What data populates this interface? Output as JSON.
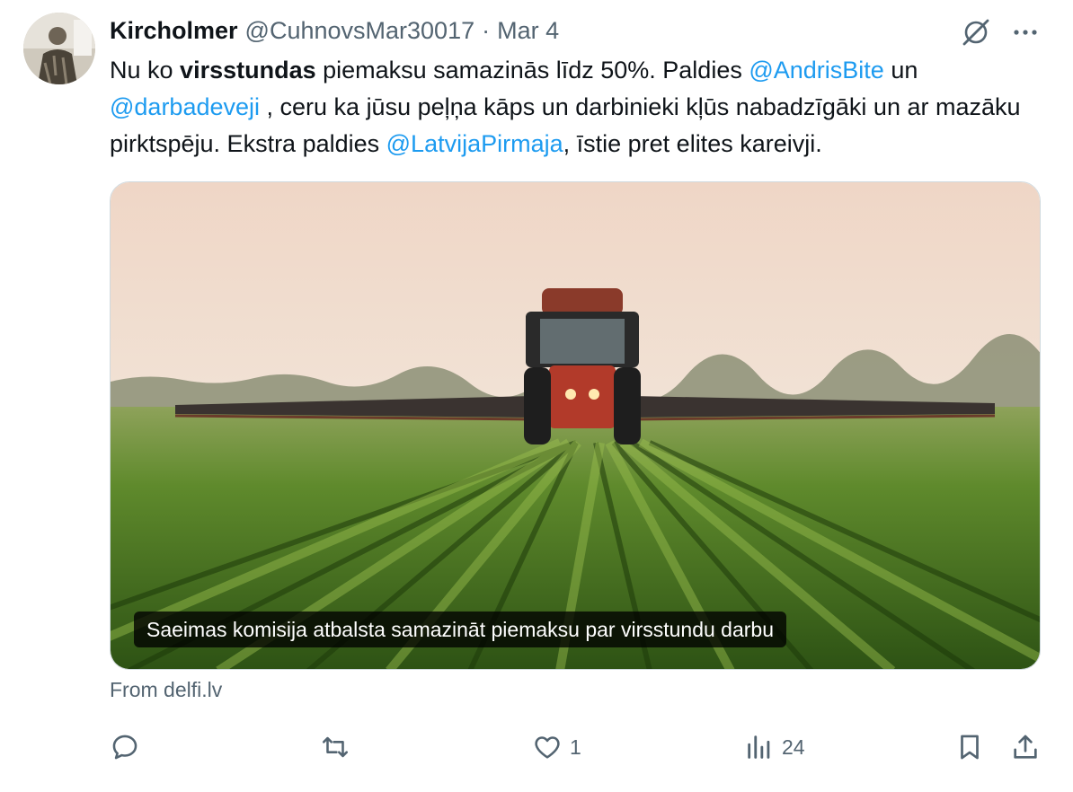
{
  "tweet": {
    "author_name": "Kircholmer",
    "author_handle": "@CuhnovsMar30017",
    "separator": "·",
    "date": "Mar 4",
    "text_segments": {
      "p1": "Nu ko ",
      "p2_bold": "virsstundas",
      "p3": " piemaksu samazinās līdz 50%. Paldies ",
      "m1": "@AndrisBite",
      "p4": " un ",
      "m2": "@darbadeveji",
      "p5": " , ceru ka jūsu peļņa kāps un darbinieki kļūs nabadzīgāki un ar mazāku pirktspēju. Ekstra paldies ",
      "m3": "@LatvijaPirmaja",
      "p6": ", īstie pret elites kareivji."
    }
  },
  "card": {
    "caption": "Saeimas komisija atbalsta samazināt piemaksu par virsstundu darbu",
    "source": "From delfi.lv"
  },
  "actions": {
    "reply": {
      "icon": "reply-icon",
      "count": ""
    },
    "retweet": {
      "icon": "retweet-icon",
      "count": ""
    },
    "like": {
      "icon": "heart-icon",
      "count": "1"
    },
    "views": {
      "icon": "views-icon",
      "count": "24"
    },
    "bookmark": {
      "icon": "bookmark-icon"
    },
    "share": {
      "icon": "share-icon"
    }
  },
  "colors": {
    "text": "#0f1419",
    "secondary": "#536471",
    "accent": "#1d9bf0"
  }
}
